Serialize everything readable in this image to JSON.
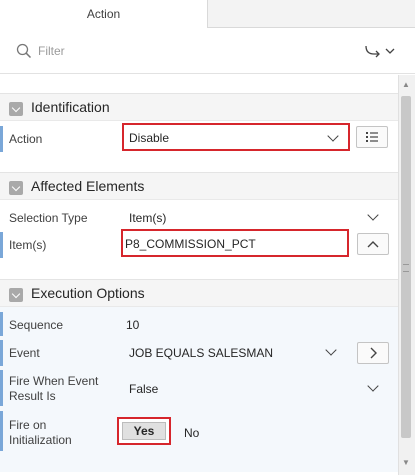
{
  "tabs": {
    "action_label": "Action"
  },
  "search": {
    "placeholder": "Filter"
  },
  "sections": {
    "identification": {
      "title": "Identification",
      "action_label": "Action",
      "action_value": "Disable"
    },
    "affected": {
      "title": "Affected Elements",
      "selection_type_label": "Selection Type",
      "selection_type_value": "Item(s)",
      "items_label": "Item(s)",
      "items_value": "P8_COMMISSION_PCT"
    },
    "execution": {
      "title": "Execution Options",
      "sequence_label": "Sequence",
      "sequence_value": "10",
      "event_label": "Event",
      "event_value": "JOB EQUALS SALESMAN",
      "fire_when_label_1": "Fire When Event",
      "fire_when_label_2": "Result Is",
      "fire_when_value": "False",
      "fire_on_init_label_1": "Fire on",
      "fire_on_init_label_2": "Initialization",
      "yes_label": "Yes",
      "no_label": "No"
    }
  },
  "colors": {
    "highlight": "#d6262c",
    "marker": "#7aa7d8",
    "section_bg": "#f5f5f5"
  },
  "icons": [
    "search-icon",
    "go-to-icon",
    "chevron-down-icon",
    "list-icon",
    "chevron-up-icon",
    "chevron-right-icon",
    "collapse-toggle-icon"
  ]
}
